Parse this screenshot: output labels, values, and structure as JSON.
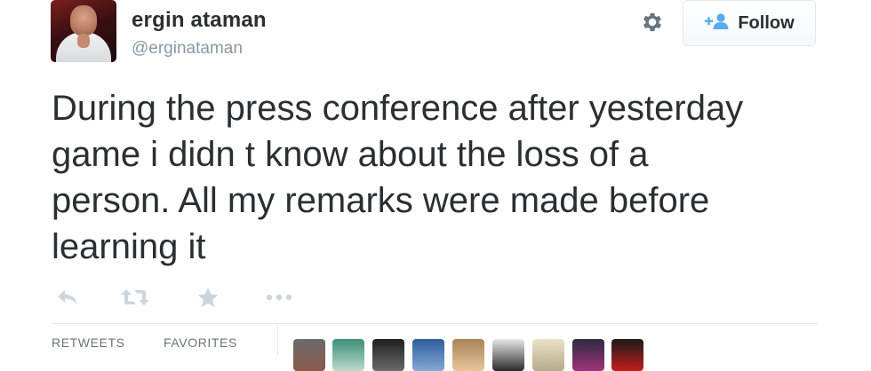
{
  "user": {
    "name": "ergin ataman",
    "handle": "@erginataman"
  },
  "header": {
    "follow_label": "Follow",
    "settings_icon": "gear-icon",
    "follow_icon": "add-user-icon"
  },
  "tweet": {
    "text": "During the press conference after yesterday\ngame i didn t know about the loss of a\nperson. All my remarks were made before\nlearning it"
  },
  "actions": [
    {
      "name": "reply-icon"
    },
    {
      "name": "retweet-icon"
    },
    {
      "name": "favorite-icon"
    },
    {
      "name": "more-icon"
    }
  ],
  "stats": {
    "retweets_label": "RETWEETS",
    "favorites_label": "FAVORITES"
  },
  "colors": {
    "text": "#292f33",
    "muted": "#8899a6",
    "action_icon": "#ccd6dd",
    "follow_icon": "#55acee",
    "border": "#e1e8ed"
  }
}
